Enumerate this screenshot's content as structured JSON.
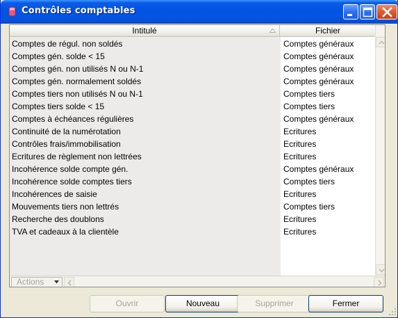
{
  "window": {
    "title": "Contrôles comptables"
  },
  "table": {
    "headers": {
      "intitule": "Intitulé",
      "fichier": "Fichier"
    },
    "rows": [
      {
        "intitule": "Comptes de régul. non soldés",
        "fichier": "Comptes généraux"
      },
      {
        "intitule": "Comptes gén.  solde < 15",
        "fichier": "Comptes généraux"
      },
      {
        "intitule": "Comptes gén. non utilisés N ou N-1",
        "fichier": "Comptes généraux"
      },
      {
        "intitule": "Comptes gén. normalement soldés",
        "fichier": "Comptes généraux"
      },
      {
        "intitule": "Comptes tiers non utilisés N ou N-1",
        "fichier": "Comptes tiers"
      },
      {
        "intitule": "Comptes tiers solde < 15",
        "fichier": "Comptes tiers"
      },
      {
        "intitule": "Comptes à échéances régulières",
        "fichier": "Comptes généraux"
      },
      {
        "intitule": "Continuité de la numérotation",
        "fichier": "Ecritures"
      },
      {
        "intitule": "Contrôles frais/immobilisation",
        "fichier": "Ecritures"
      },
      {
        "intitule": "Ecritures de règlement non lettrées",
        "fichier": "Ecritures"
      },
      {
        "intitule": "Incohérence solde compte gén.",
        "fichier": "Comptes généraux"
      },
      {
        "intitule": "Incohérence solde comptes tiers",
        "fichier": "Comptes tiers"
      },
      {
        "intitule": "Incohérences de saisie",
        "fichier": "Ecritures"
      },
      {
        "intitule": "Mouvements tiers non lettrés",
        "fichier": "Comptes tiers"
      },
      {
        "intitule": "Recherche des doublons",
        "fichier": "Ecritures"
      },
      {
        "intitule": "TVA et cadeaux à la clientèle",
        "fichier": "Ecritures"
      }
    ]
  },
  "actions_menu": {
    "label": "Actions"
  },
  "buttons": {
    "ouvrir": "Ouvrir",
    "nouveau": "Nouveau",
    "supprimer": "Supprimer",
    "fermer": "Fermer"
  },
  "icons": {
    "app": "app-icon",
    "minimize": "minimize-icon",
    "maximize": "maximize-icon",
    "close": "close-icon",
    "sort": "sort-ascending-icon",
    "scroll_up": "arrow-up-icon",
    "scroll_down": "arrow-down-icon",
    "scroll_left": "arrow-left-icon",
    "scroll_right": "arrow-right-icon",
    "dropdown": "chevron-down-icon",
    "grip": "resize-grip-icon"
  },
  "colors": {
    "titlebar": "#0453e4",
    "window_bg": "#ece9d8",
    "close_button": "#e05a2b",
    "first_column_bg": "#ecebea"
  }
}
